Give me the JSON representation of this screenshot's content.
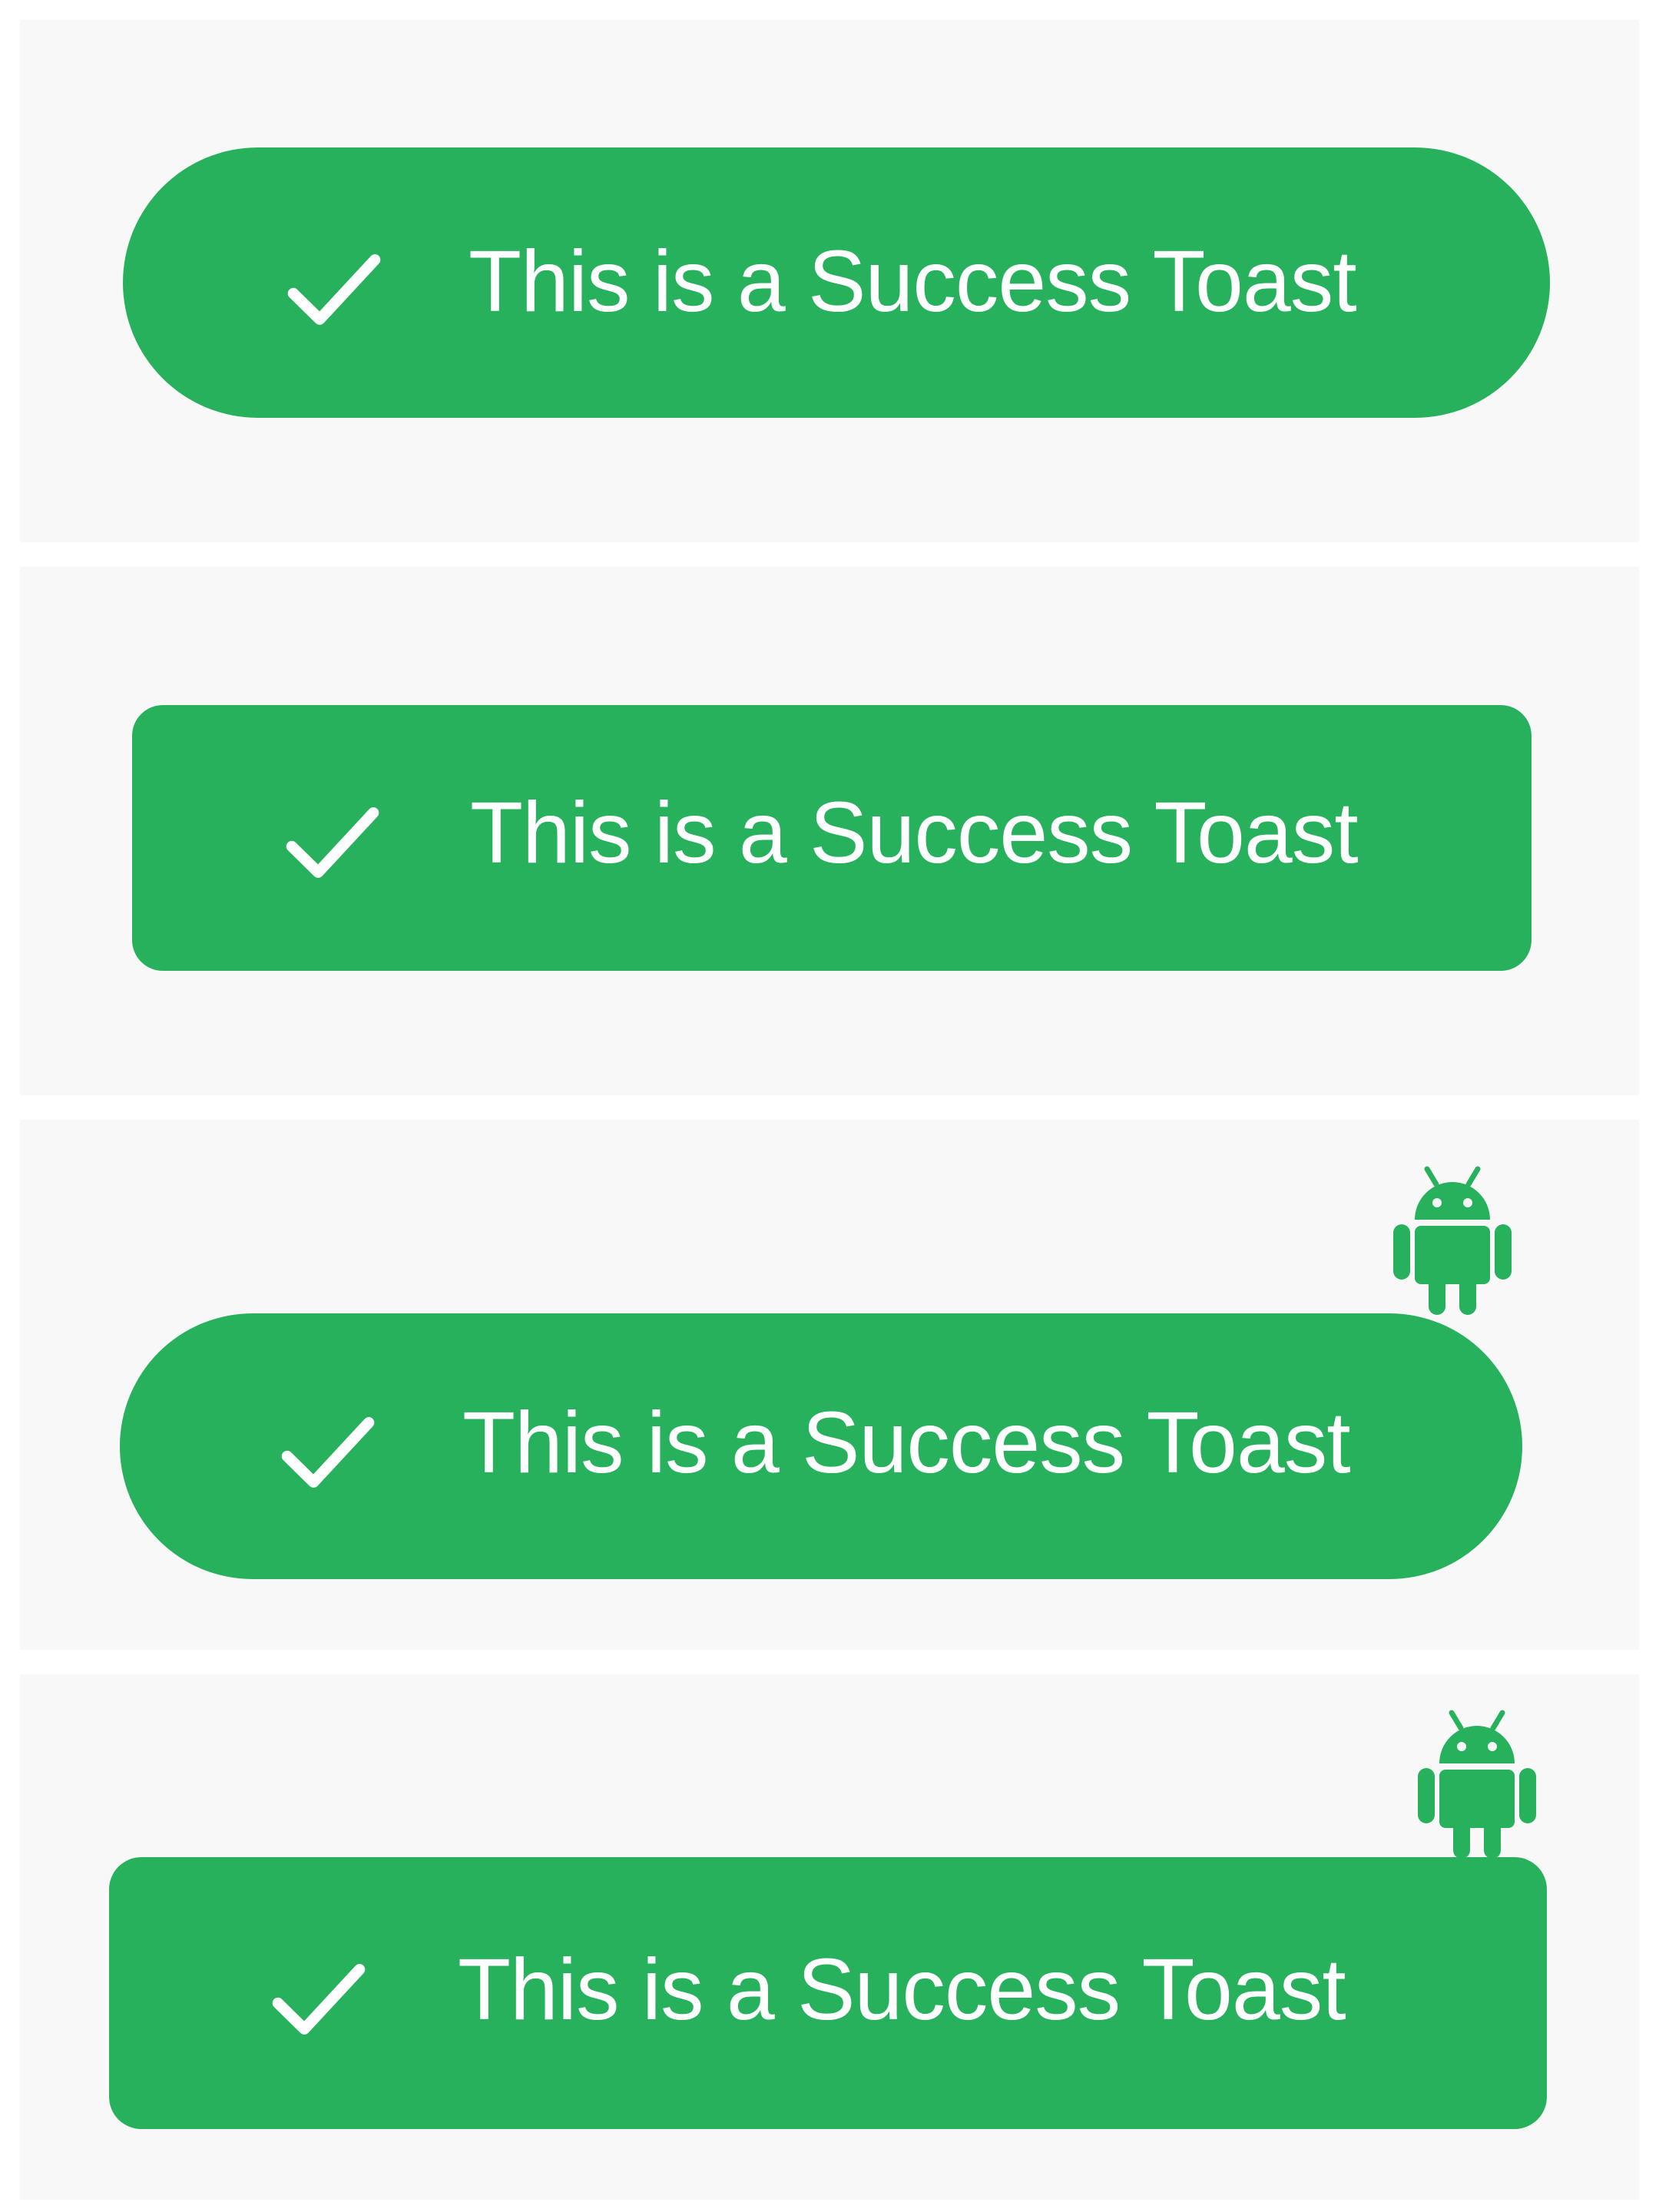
{
  "colors": {
    "toast_background": "#27b15c",
    "toast_text": "#ffffff",
    "panel_background": "#f8f8f8",
    "page_background": "#ffffff"
  },
  "toasts": [
    {
      "style": "pill",
      "icon": "checkmark-icon",
      "message": "This is a Success Toast",
      "has_android_icon": false
    },
    {
      "style": "rounded-rectangle",
      "icon": "checkmark-icon",
      "message": "This is a Success Toast",
      "has_android_icon": false
    },
    {
      "style": "pill",
      "icon": "checkmark-icon",
      "message": "This is a Success Toast",
      "has_android_icon": true
    },
    {
      "style": "rounded-rectangle",
      "icon": "checkmark-icon",
      "message": "This is a Success Toast",
      "has_android_icon": true
    }
  ]
}
